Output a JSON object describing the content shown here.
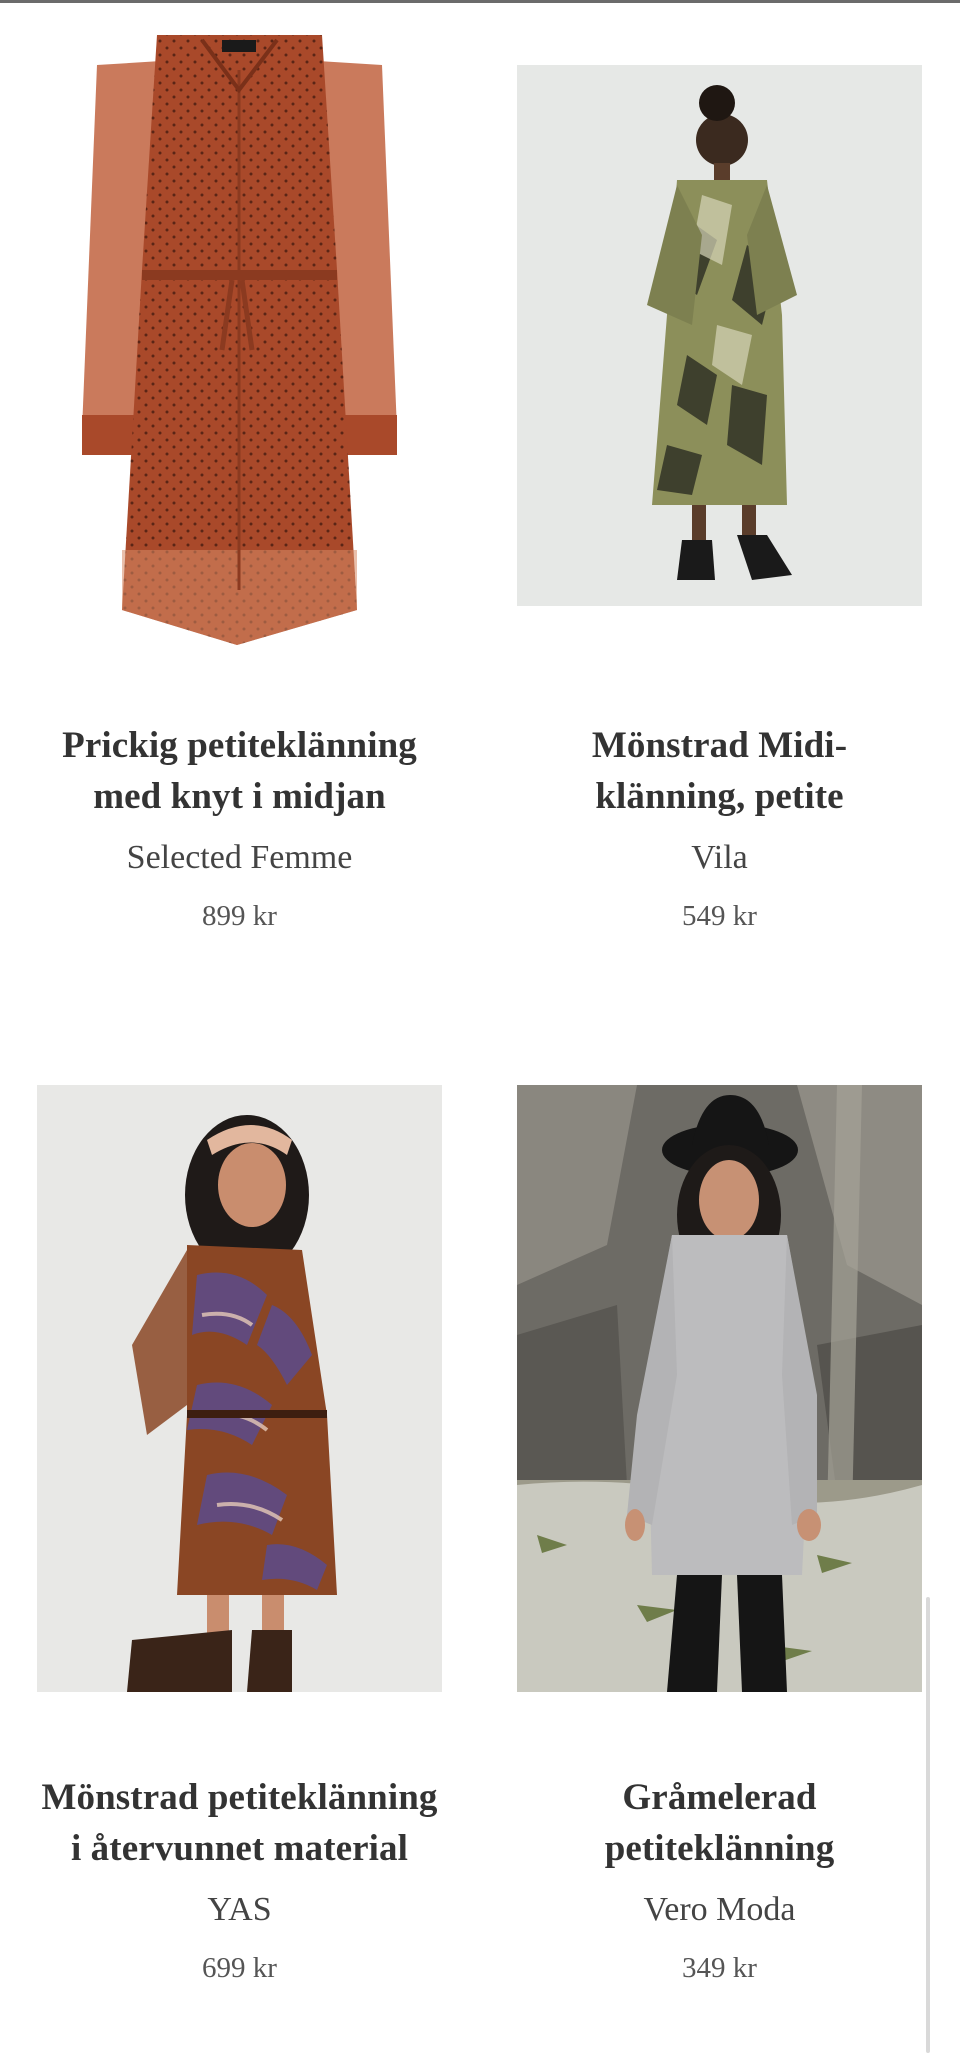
{
  "products": [
    {
      "title_line1": "Prickig petiteklänning",
      "title_line2": "med knyt i midjan",
      "brand": "Selected Femme",
      "price": "899 kr",
      "image_desc": "rust dotted shirt dress"
    },
    {
      "title_line1": "Mönstrad Midi-",
      "title_line2": "klänning, petite",
      "brand": "Vila",
      "price": "549 kr",
      "image_desc": "olive patterned midi dress"
    },
    {
      "title_line1": "Mönstrad petiteklänning",
      "title_line2": "i återvunnet material",
      "brand": "YAS",
      "price": "699 kr",
      "image_desc": "brown purple patterned dress"
    },
    {
      "title_line1": "Gråmelerad",
      "title_line2": "petiteklänning",
      "brand": "Vero Moda",
      "price": "349 kr",
      "image_desc": "grey knit dress"
    }
  ],
  "colors": {
    "rust": "#a9492a",
    "olive": "#8c8f5a",
    "background": "#ffffff"
  }
}
